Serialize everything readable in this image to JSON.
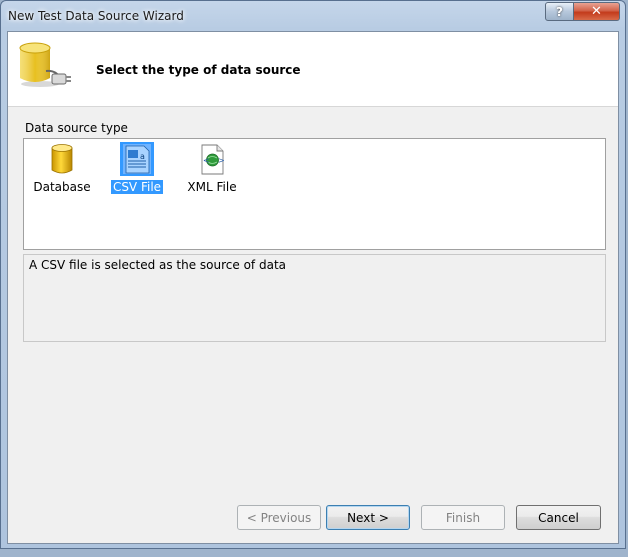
{
  "window": {
    "title": "New Test Data Source Wizard",
    "help_label": "?",
    "close_label": "✕"
  },
  "header": {
    "title": "Select the type of data source",
    "icon": "database-plug-icon"
  },
  "source_types": {
    "label": "Data source type",
    "items": [
      {
        "label": "Database",
        "icon": "database-icon",
        "selected": false
      },
      {
        "label": "CSV File",
        "icon": "csv-file-icon",
        "selected": true
      },
      {
        "label": "XML File",
        "icon": "xml-file-icon",
        "selected": false
      }
    ]
  },
  "description": "A CSV file is selected as the source of data",
  "buttons": {
    "previous": "< Previous",
    "next": "Next >",
    "finish": "Finish",
    "cancel": "Cancel"
  },
  "colors": {
    "selection": "#3399ff",
    "close_button": "#c8452a"
  }
}
